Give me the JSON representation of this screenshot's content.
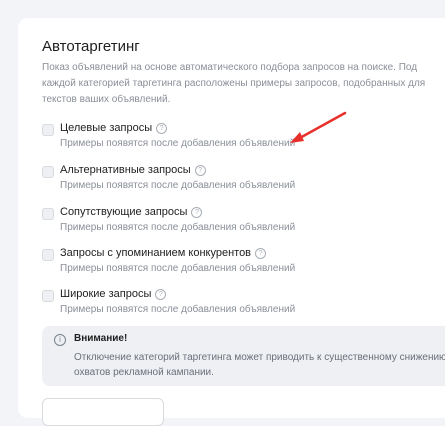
{
  "section": {
    "title": "Автотаргетинг",
    "description": "Показ объявлений на основе автоматического подбора запросов на поиске. Под каждой категорией таргетинга расположены примеры запросов, подобранных для текстов ваших объявлений."
  },
  "options": [
    {
      "label": "Целевые запросы",
      "hint": "Примеры появятся после добавления объявлений",
      "checked": false
    },
    {
      "label": "Альтернативные запросы",
      "hint": "Примеры появятся после добавления объявлений",
      "checked": false
    },
    {
      "label": "Сопутствующие запросы",
      "hint": "Примеры появятся после добавления объявлений",
      "checked": false
    },
    {
      "label": "Запросы с упоминанием конкурентов",
      "hint": "Примеры появятся после добавления объявлений",
      "checked": false
    },
    {
      "label": "Широкие запросы",
      "hint": "Примеры появятся после добавления объявлений",
      "checked": false
    }
  ],
  "warning": {
    "title": "Внимание!",
    "text": "Отключение категорий таргетинга может приводить к существенному снижению охватов рекламной кампании."
  },
  "colors": {
    "arrow": "#e8302b",
    "background": "#f2f4f7",
    "card": "#ffffff",
    "muted_text": "#8a8f98"
  },
  "icons": {
    "help": "question-circle-icon",
    "info": "info-circle-icon",
    "annotation": "red-arrow-icon"
  }
}
